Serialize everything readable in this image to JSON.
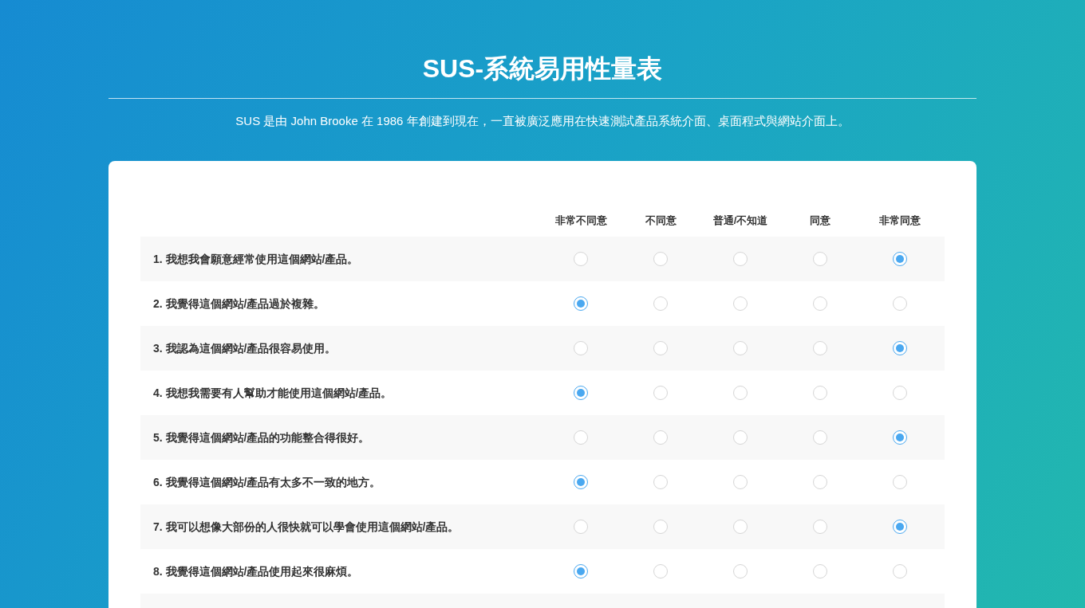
{
  "title": "SUS-系統易用性量表",
  "subtitle": "SUS 是由 John Brooke 在 1986 年創建到現在，一直被廣泛應用在快速測試產品系統介面、桌面程式與網站介面上。",
  "columns": [
    "非常不同意",
    "不同意",
    "普通/不知道",
    "同意",
    "非常同意"
  ],
  "questions": [
    {
      "text": "1. 我想我會願意經常使用這個網站/產品。",
      "choices": [
        {
          "selected": false
        },
        {
          "selected": false
        },
        {
          "selected": false
        },
        {
          "selected": false
        },
        {
          "selected": true
        }
      ]
    },
    {
      "text": "2. 我覺得這個網站/產品過於複雜。",
      "choices": [
        {
          "selected": true
        },
        {
          "selected": false
        },
        {
          "selected": false
        },
        {
          "selected": false
        },
        {
          "selected": false
        }
      ]
    },
    {
      "text": "3. 我認為這個網站/產品很容易使用。",
      "choices": [
        {
          "selected": false
        },
        {
          "selected": false
        },
        {
          "selected": false
        },
        {
          "selected": false
        },
        {
          "selected": true
        }
      ]
    },
    {
      "text": "4. 我想我需要有人幫助才能使用這個網站/產品。",
      "choices": [
        {
          "selected": true
        },
        {
          "selected": false
        },
        {
          "selected": false
        },
        {
          "selected": false
        },
        {
          "selected": false
        }
      ]
    },
    {
      "text": "5. 我覺得這個網站/產品的功能整合得很好。",
      "choices": [
        {
          "selected": false
        },
        {
          "selected": false
        },
        {
          "selected": false
        },
        {
          "selected": false
        },
        {
          "selected": true
        }
      ]
    },
    {
      "text": "6. 我覺得這個網站/產品有太多不一致的地方。",
      "choices": [
        {
          "selected": true
        },
        {
          "selected": false
        },
        {
          "selected": false
        },
        {
          "selected": false
        },
        {
          "selected": false
        }
      ]
    },
    {
      "text": "7. 我可以想像大部份的人很快就可以學會使用這個網站/產品。",
      "choices": [
        {
          "selected": false
        },
        {
          "selected": false
        },
        {
          "selected": false
        },
        {
          "selected": false
        },
        {
          "selected": true
        }
      ]
    },
    {
      "text": "8. 我覺得這個網站/產品使用起來很麻煩。",
      "choices": [
        {
          "selected": true
        },
        {
          "selected": false
        },
        {
          "selected": false
        },
        {
          "selected": false
        },
        {
          "selected": false
        }
      ]
    }
  ]
}
